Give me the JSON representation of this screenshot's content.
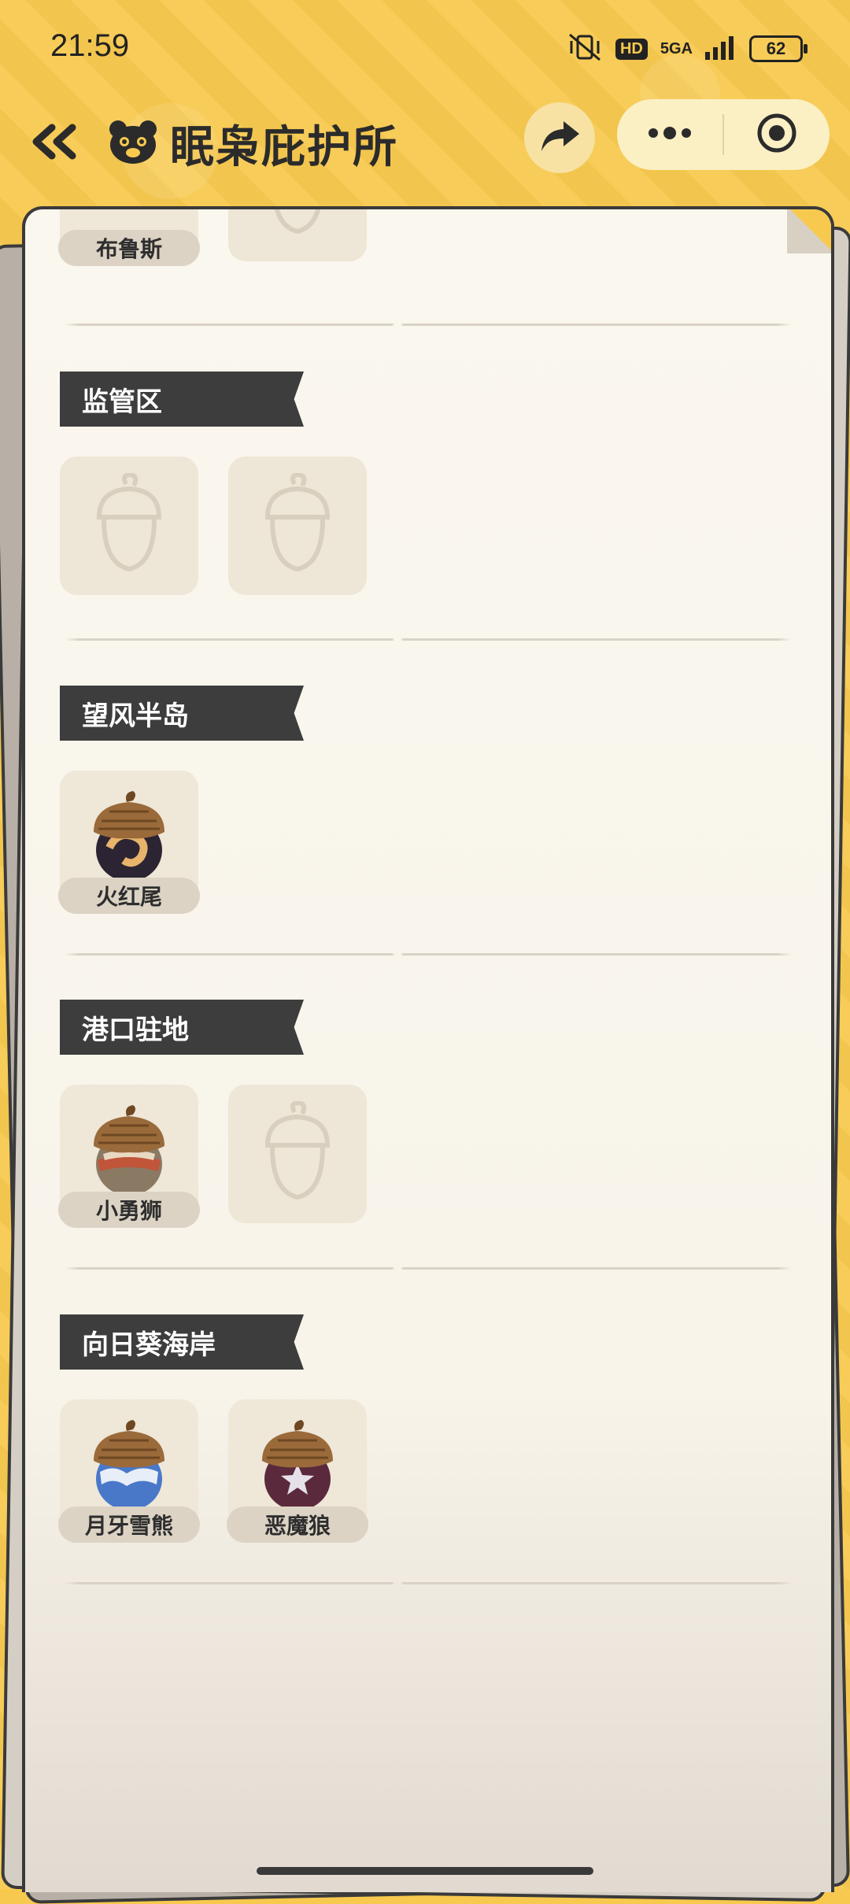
{
  "status_bar": {
    "time": "21:59",
    "hd": "HD",
    "network": "5GA",
    "battery": "62"
  },
  "header": {
    "title": "眠枭庇护所",
    "icons": [
      "back-double-chevron-icon",
      "bear-logo-icon",
      "share-arrow-icon",
      "more-dots-icon",
      "target-close-icon"
    ]
  },
  "top_slot": {
    "name": "布鲁斯"
  },
  "sections": [
    {
      "label": "监管区",
      "slots": [
        {
          "state": "empty"
        },
        {
          "state": "empty"
        }
      ]
    },
    {
      "label": "望风半岛",
      "slots": [
        {
          "state": "filled",
          "name": "火红尾",
          "accent": "#c9682a"
        }
      ]
    },
    {
      "label": "港口驻地",
      "slots": [
        {
          "state": "filled",
          "name": "小勇狮",
          "accent": "#b2583a"
        },
        {
          "state": "empty"
        }
      ]
    },
    {
      "label": "向日葵海岸",
      "slots": [
        {
          "state": "filled",
          "name": "月牙雪熊",
          "accent": "#4a78c9"
        },
        {
          "state": "filled",
          "name": "恶魔狼",
          "accent": "#5a2a3c"
        }
      ]
    }
  ],
  "colors": {
    "background_yellow": "#f7c94f",
    "label_dark": "#3d3d3d",
    "card_cream": "#faf7ef"
  }
}
